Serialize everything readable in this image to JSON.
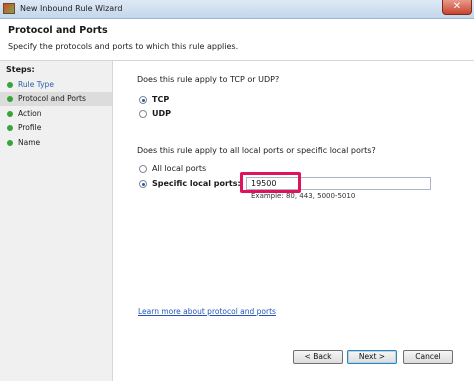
{
  "window": {
    "title": "New Inbound Rule Wizard",
    "close_glyph": "✕"
  },
  "header": {
    "title": "Protocol and Ports",
    "subtitle": "Specify the protocols and ports to which this rule applies."
  },
  "steps": {
    "title": "Steps:",
    "items": [
      {
        "label": "Rule Type",
        "state": "done",
        "color": "#3aa33a"
      },
      {
        "label": "Protocol and Ports",
        "state": "current",
        "color": "#3aa33a"
      },
      {
        "label": "Action",
        "state": "pending",
        "color": "#3aa33a"
      },
      {
        "label": "Profile",
        "state": "pending",
        "color": "#3aa33a"
      },
      {
        "label": "Name",
        "state": "pending",
        "color": "#3aa33a"
      }
    ]
  },
  "main": {
    "protocol_question": "Does this rule apply to TCP or UDP?",
    "protocol_options": [
      {
        "label": "TCP",
        "selected": true
      },
      {
        "label": "UDP",
        "selected": false
      }
    ],
    "ports_question": "Does this rule apply to all local ports or specific local ports?",
    "port_options": [
      {
        "label": "All local ports",
        "selected": false
      },
      {
        "label": "Specific local ports:",
        "selected": true
      }
    ],
    "ports_value": "19500",
    "ports_example": "Example: 80, 443, 5000-5010",
    "learn_more": "Learn more about protocol and ports"
  },
  "buttons": {
    "back": "< Back",
    "next": "Next >",
    "cancel": "Cancel"
  },
  "colors": {
    "highlight": "#e0125e",
    "link": "#2355b8",
    "step_bullet": "#3aa33a"
  }
}
